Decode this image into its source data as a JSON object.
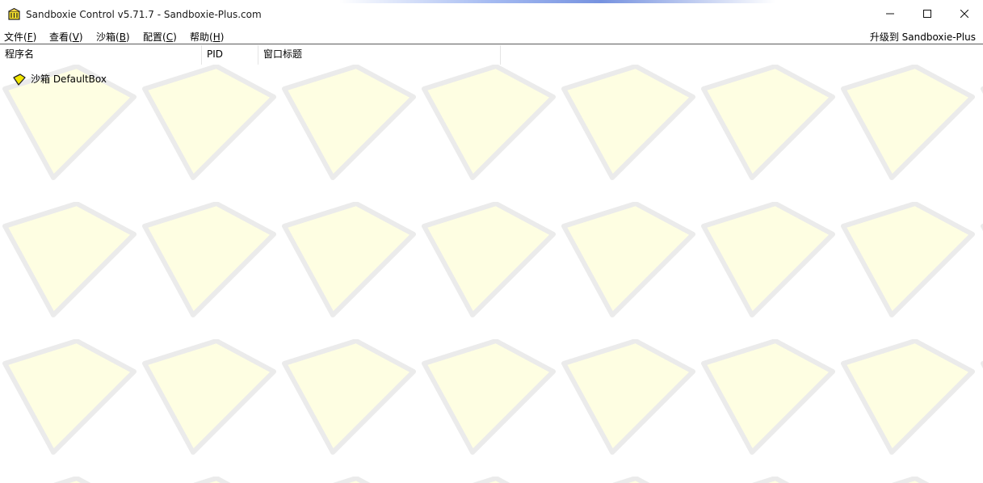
{
  "window": {
    "title": "Sandboxie Control v5.71.7 - Sandboxie-Plus.com",
    "icon": "sandboxie-app-icon",
    "controls": {
      "minimize": "minimize-icon",
      "maximize": "maximize-icon",
      "close": "close-icon"
    }
  },
  "menu": {
    "file": {
      "text": "文件(",
      "mnemonic": "F",
      "end": ")"
    },
    "view": {
      "text": "查看(",
      "mnemonic": "V",
      "end": ")"
    },
    "sandbox": {
      "text": "沙箱(",
      "mnemonic": "B",
      "end": ")"
    },
    "config": {
      "text": "配置(",
      "mnemonic": "C",
      "end": ")"
    },
    "help": {
      "text": "帮助(",
      "mnemonic": "H",
      "end": ")"
    },
    "upgrade": "升级到 Sandboxie-Plus"
  },
  "columns": {
    "name": "程序名",
    "pid": "PID",
    "window_title": "窗口标题"
  },
  "tree": {
    "items": [
      {
        "label": "沙箱 DefaultBox",
        "icon": "sandbox-icon"
      }
    ]
  },
  "colors": {
    "watermark_fill": "#fefee2",
    "watermark_stroke": "#ebebeb",
    "sandbox_icon": "#f2e600",
    "menu_separator": "#5c5c5c"
  }
}
